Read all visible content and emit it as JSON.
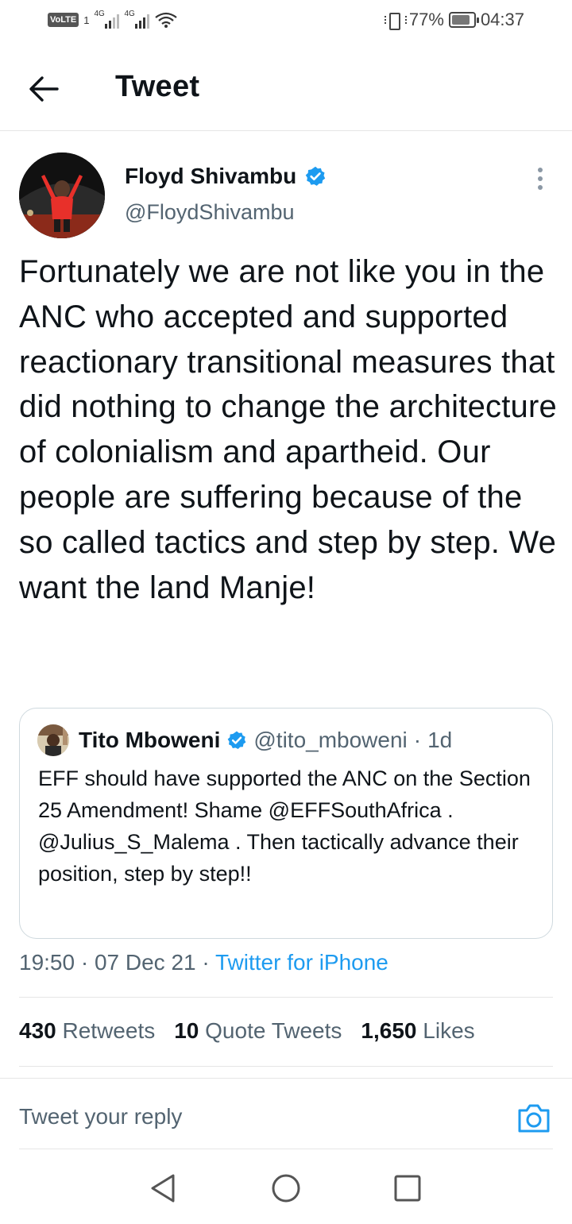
{
  "status_bar": {
    "volte": "VoLTE",
    "sim": "1",
    "network1": "4G",
    "network2": "4G",
    "battery_percent": "77%",
    "time": "04:37"
  },
  "header": {
    "title": "Tweet"
  },
  "tweet": {
    "author_name": "Floyd Shivambu",
    "author_handle": "@FloydShivambu",
    "verified": true,
    "text": "Fortunately we are not like you in the ANC who accepted and supported reactionary transitional measures that did nothing to change the architecture of colonialism and apartheid. Our people are suffering because of the so called tactics and step by step. We want the land Manje!",
    "quoted": {
      "author_name": "Tito Mboweni",
      "author_handle": "@tito_mboweni",
      "separator": "·",
      "age": "1d",
      "text": "EFF should have supported the ANC on the Section 25 Amendment! Shame @EFFSouthAfrica . @Julius_S_Malema . Then tactically advance their position, step by step!!"
    },
    "time": "19:50",
    "date": "07 Dec 21",
    "separator": "·",
    "source": "Twitter for iPhone",
    "stats": {
      "retweets_count": "430",
      "retweets_label": "Retweets",
      "quotes_count": "10",
      "quotes_label": "Quote Tweets",
      "likes_count": "1,650",
      "likes_label": "Likes"
    }
  },
  "reply": {
    "placeholder": "Tweet your reply"
  },
  "colors": {
    "accent": "#1d9bf0",
    "secondary_text": "#536471",
    "primary_text": "#0f1419",
    "border": "#cfd9de"
  },
  "icons": [
    "back-arrow-icon",
    "verified-badge-icon",
    "more-options-icon",
    "camera-icon",
    "nav-back-icon",
    "nav-home-icon",
    "nav-recents-icon"
  ]
}
